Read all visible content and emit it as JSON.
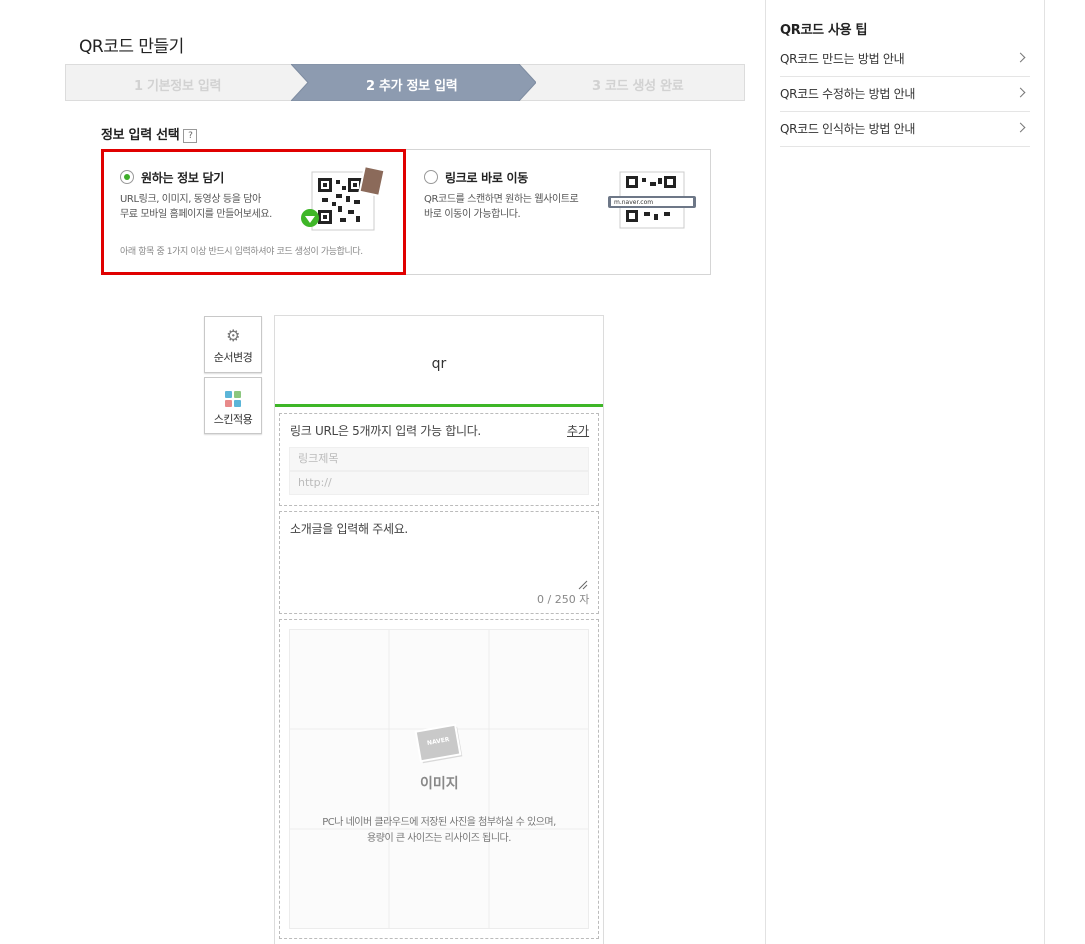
{
  "header": {
    "title": "QR코드 만들기"
  },
  "steps": [
    {
      "label": "1 기본정보 입력",
      "active": false
    },
    {
      "label": "2 추가 정보 입력",
      "active": true
    },
    {
      "label": "3 코드 생성 완료",
      "active": false
    }
  ],
  "info_section": {
    "title": "정보 입력 선택",
    "help": "?",
    "option1": {
      "title": "원하는 정보 담기",
      "desc1": "URL링크, 이미지, 동영상 등을 담아",
      "desc2": "무료 모바일 홈페이지를 만들어보세요.",
      "note": "아래 항목 중 1가지 이상 반드시 입력하셔야 코드 생성이 가능합니다.",
      "selected": true
    },
    "option2": {
      "title": "링크로 바로 이동",
      "desc1": "QR코드를 스캔하면 원하는 웹사이트로",
      "desc2": "바로 이동이 가능합니다.",
      "url_sample": "m.naver.com",
      "selected": false
    }
  },
  "side_buttons": {
    "order": {
      "label": "순서변경",
      "icon": "gear-icon"
    },
    "skin": {
      "label": "스킨적용",
      "icon": "grid-icon"
    }
  },
  "editor": {
    "title": "qr",
    "link": {
      "note": "링크 URL은 5개까지 입력 가능 합니다.",
      "add_label": "추가",
      "title_placeholder": "링크제목",
      "url_placeholder": "http://"
    },
    "intro": {
      "placeholder": "소개글을 입력해 주세요.",
      "counter": "0 / 250 자"
    },
    "image": {
      "badge": "NAVER",
      "title": "이미지",
      "desc1": "PC나 네이버 클라우드에 저장된 사진을 첨부하실 수 있으며,",
      "desc2": "용량이 큰 사이즈는 리사이즈 됩니다."
    }
  },
  "tips": {
    "title": "QR코드 사용 팁",
    "items": [
      {
        "label": "QR코드 만드는 방법 안내"
      },
      {
        "label": "QR코드 수정하는 방법 안내"
      },
      {
        "label": "QR코드 인식하는 방법 안내"
      }
    ]
  },
  "colors": {
    "accent_green": "#3eb627",
    "selection_red": "#e00000",
    "step_active": "#8d9bb0"
  }
}
